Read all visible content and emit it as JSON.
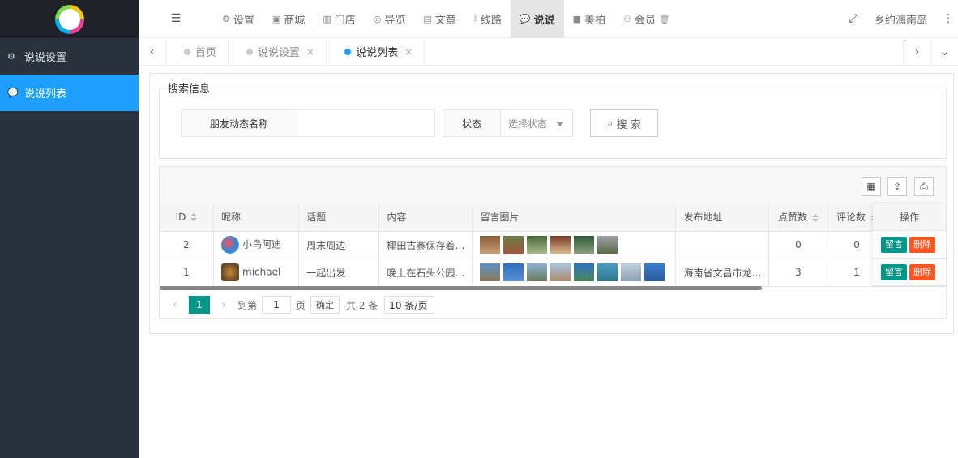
{
  "sidebar": {
    "items": [
      {
        "label": "说说设置",
        "icon": "gears-icon",
        "active": false
      },
      {
        "label": "说说列表",
        "icon": "wechat-icon",
        "active": true
      }
    ]
  },
  "topnav": {
    "items": [
      {
        "label": "设置",
        "icon": "gears-icon"
      },
      {
        "label": "商城",
        "icon": "shop-icon"
      },
      {
        "label": "门店",
        "icon": "bank-icon"
      },
      {
        "label": "导览",
        "icon": "bicycle-icon"
      },
      {
        "label": "文章",
        "icon": "newspaper-icon"
      },
      {
        "label": "线路",
        "icon": "route-icon"
      },
      {
        "label": "说说",
        "icon": "wechat-icon",
        "active": true
      },
      {
        "label": "美拍",
        "icon": "video-icon"
      },
      {
        "label": "会员",
        "icon": "users-icon"
      }
    ],
    "region": "乡约海南岛"
  },
  "tabs": [
    {
      "label": "首页",
      "closable": false,
      "active": false
    },
    {
      "label": "说说设置",
      "closable": true,
      "active": false
    },
    {
      "label": "说说列表",
      "closable": true,
      "active": true
    }
  ],
  "search": {
    "legend": "搜索信息",
    "name_label": "朋友动态名称",
    "name_value": "",
    "status_label": "状态",
    "status_placeholder": "选择状态",
    "button_label": "搜 索"
  },
  "table": {
    "headers": [
      "ID",
      "昵称",
      "话题",
      "内容",
      "留言图片",
      "发布地址",
      "点赞数",
      "评论数",
      "操作"
    ],
    "rows": [
      {
        "id": "2",
        "nickname": "小鸟阿迪",
        "topic": "周末周边",
        "content": "椰田古寨保存着…",
        "address": "",
        "likes": "0",
        "comments": "0"
      },
      {
        "id": "1",
        "nickname": "michael",
        "topic": "一起出发",
        "content": "晚上在石头公园…",
        "address": "海南省文昌市龙…",
        "likes": "3",
        "comments": "1"
      }
    ],
    "actions": {
      "reply": "留言",
      "delete": "删除"
    }
  },
  "pager": {
    "current": "1",
    "goto_label": "到第",
    "goto_value": "1",
    "page_unit": "页",
    "confirm": "确定",
    "total": "共 2 条",
    "page_size": "10 条/页"
  },
  "colors": {
    "sidebar_bg": "#28333e",
    "accent_blue": "#1e9fff",
    "green": "#009688",
    "red": "#ff5722"
  }
}
